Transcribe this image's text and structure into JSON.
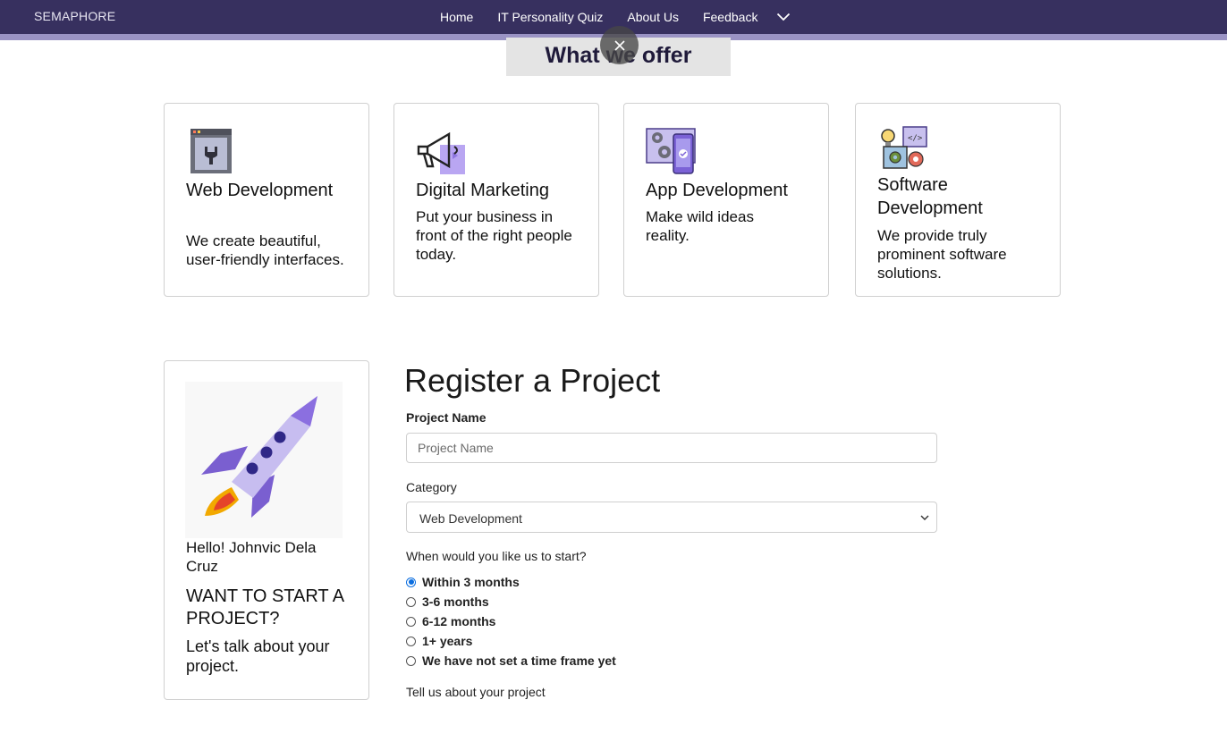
{
  "navbar": {
    "brand": "SEMAPHORE",
    "links": [
      "Home",
      "IT Personality Quiz",
      "About Us",
      "Feedback"
    ],
    "bg_color": "#37305f",
    "stripe_color": "#9a93c4"
  },
  "offer": {
    "title": "What we offer"
  },
  "services": [
    {
      "title": "Web Development",
      "description": "We create beautiful, user-friendly interfaces.",
      "icon": "web-development-icon"
    },
    {
      "title": "Digital Marketing",
      "description": "Put your business in front of the right people today.",
      "icon": "megaphone-icon"
    },
    {
      "title": "App Development",
      "description": "Make wild ideas reality.",
      "icon": "mobile-app-icon"
    },
    {
      "title": "Software Development",
      "description": "We provide truly prominent software solutions.",
      "icon": "software-gears-icon"
    }
  ],
  "profile": {
    "greeting": "Hello! Johnvic Dela Cruz",
    "headline": "WANT TO START A PROJECT?",
    "subtext": "Let's talk about your project.",
    "illustration": "rocket-icon"
  },
  "form": {
    "title": "Register a Project",
    "project_name_label": "Project Name",
    "project_name_placeholder": "Project Name",
    "category_label": "Category",
    "category_value": "Web Development",
    "start_label": "When would you like us to start?",
    "start_options": [
      "Within 3 months",
      "3-6 months",
      "6-12 months",
      "1+ years",
      "We have not set a time frame yet"
    ],
    "start_selected": "Within 3 months",
    "about_label": "Tell us about your project"
  }
}
